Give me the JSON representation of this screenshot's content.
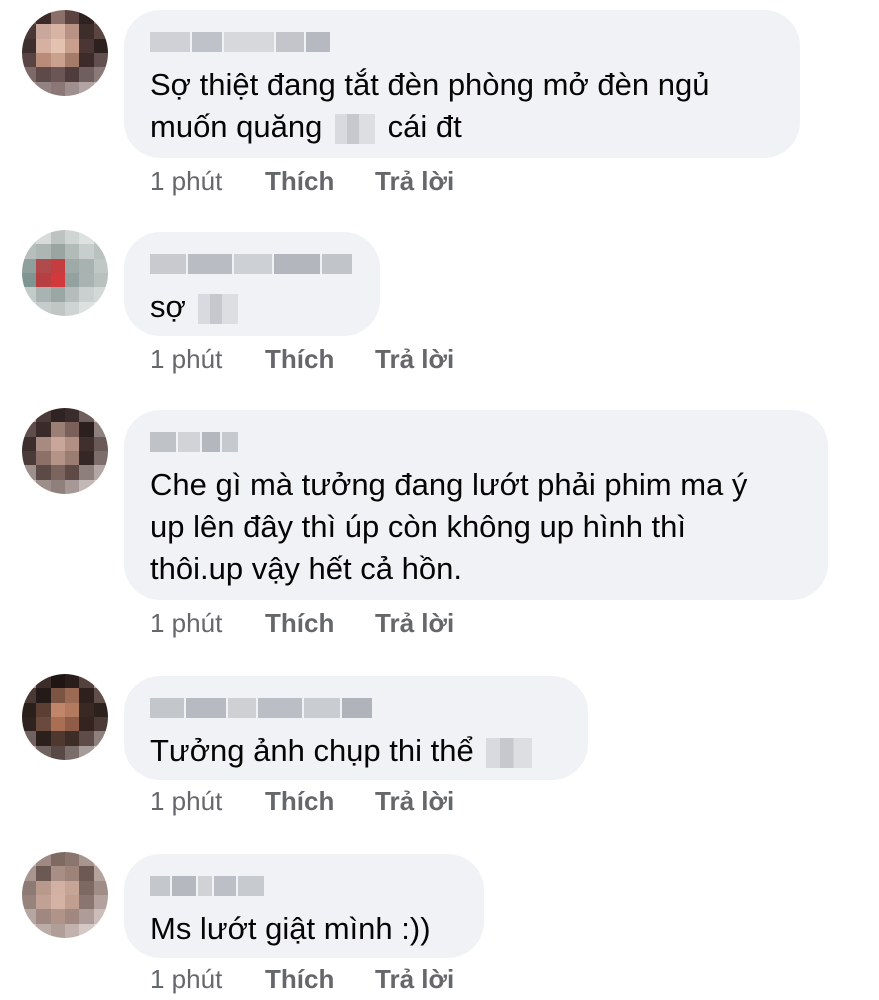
{
  "comments": [
    {
      "text_before": "Sợ thiệt đang tắt đèn phòng mở đèn ngủ\nmuốn quăng ",
      "text_after": " cái đt",
      "time": "1 phút",
      "like": "Thích",
      "reply": "Trả lời"
    },
    {
      "text_before": "sợ ",
      "text_after": "",
      "time": "1 phút",
      "like": "Thích",
      "reply": "Trả lời"
    },
    {
      "text_before": "Che gì mà tưởng đang lướt phải phim ma ý\nup lên đây thì úp còn không up hình thì\nthôi.up vậy hết cả hồn.",
      "text_after": "",
      "time": "1 phút",
      "like": "Thích",
      "reply": "Trả lời"
    },
    {
      "text_before": "Tưởng ảnh chụp thi thể ",
      "text_after": "",
      "time": "1 phút",
      "like": "Thích",
      "reply": "Trả lời"
    },
    {
      "text_before": "Ms lướt giật mình :))",
      "text_after": "",
      "time": "1 phút",
      "like": "Thích",
      "reply": "Trả lời"
    }
  ],
  "colors": {
    "bubble": "#f0f2f5",
    "text": "#050505",
    "meta": "#65676b"
  }
}
